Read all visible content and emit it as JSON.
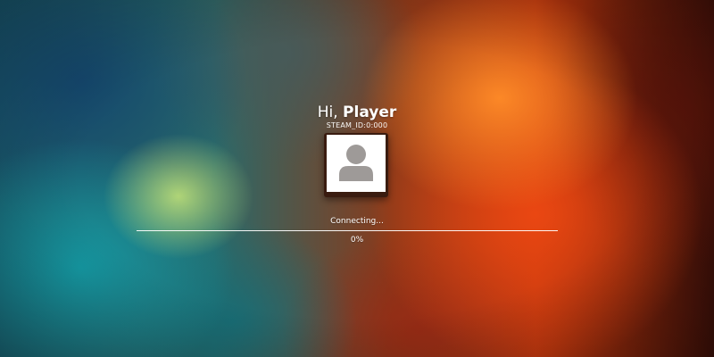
{
  "greeting": {
    "prefix": "Hi, ",
    "player_name": "Player"
  },
  "steam_id": "STEAM_ID:0:000",
  "avatar": {
    "icon": "user-icon",
    "background_color": "#ffffff",
    "icon_color": "#9e9a98"
  },
  "loading": {
    "status": "Connecting...",
    "progress_text": "0%",
    "progress_fraction": 0,
    "bar_color": "#ffffff"
  }
}
